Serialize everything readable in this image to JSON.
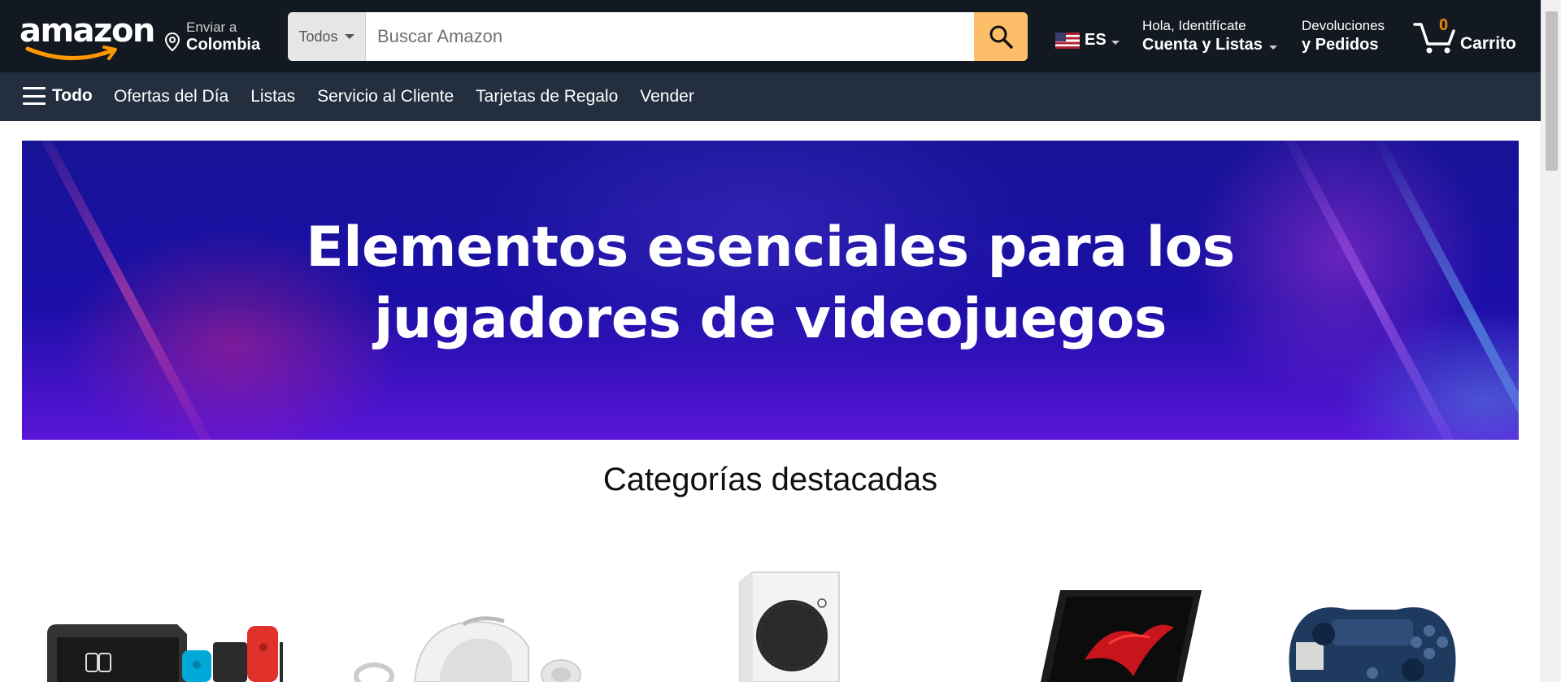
{
  "header": {
    "logo": "amazon",
    "deliver_to": {
      "line1": "Enviar a",
      "line2": "Colombia"
    },
    "search": {
      "category": "Todos",
      "placeholder": "Buscar Amazon"
    },
    "language": "ES",
    "account": {
      "line1": "Hola, Identifícate",
      "line2": "Cuenta y Listas"
    },
    "returns": {
      "line1": "Devoluciones",
      "line2": "y Pedidos"
    },
    "cart": {
      "count": "0",
      "label": "Carrito"
    }
  },
  "subnav": {
    "all_label": "Todo",
    "links": [
      "Ofertas del Día",
      "Listas",
      "Servicio al Cliente",
      "Tarjetas de Regalo",
      "Vender"
    ]
  },
  "hero": {
    "line1": "Elementos esenciales para los",
    "line2": "jugadores de videojuegos"
  },
  "categories": {
    "title": "Categorías destacadas",
    "items": [
      {
        "icon": "nintendo-switch-image"
      },
      {
        "icon": "vr-headset-image"
      },
      {
        "icon": "xbox-series-s-image"
      },
      {
        "icon": "gaming-laptop-image"
      },
      {
        "icon": "game-controller-image"
      }
    ]
  },
  "colors": {
    "nav_bg": "#131921",
    "subnav_bg": "#232f3e",
    "search_button": "#febd69",
    "cart_count": "#f08804"
  }
}
